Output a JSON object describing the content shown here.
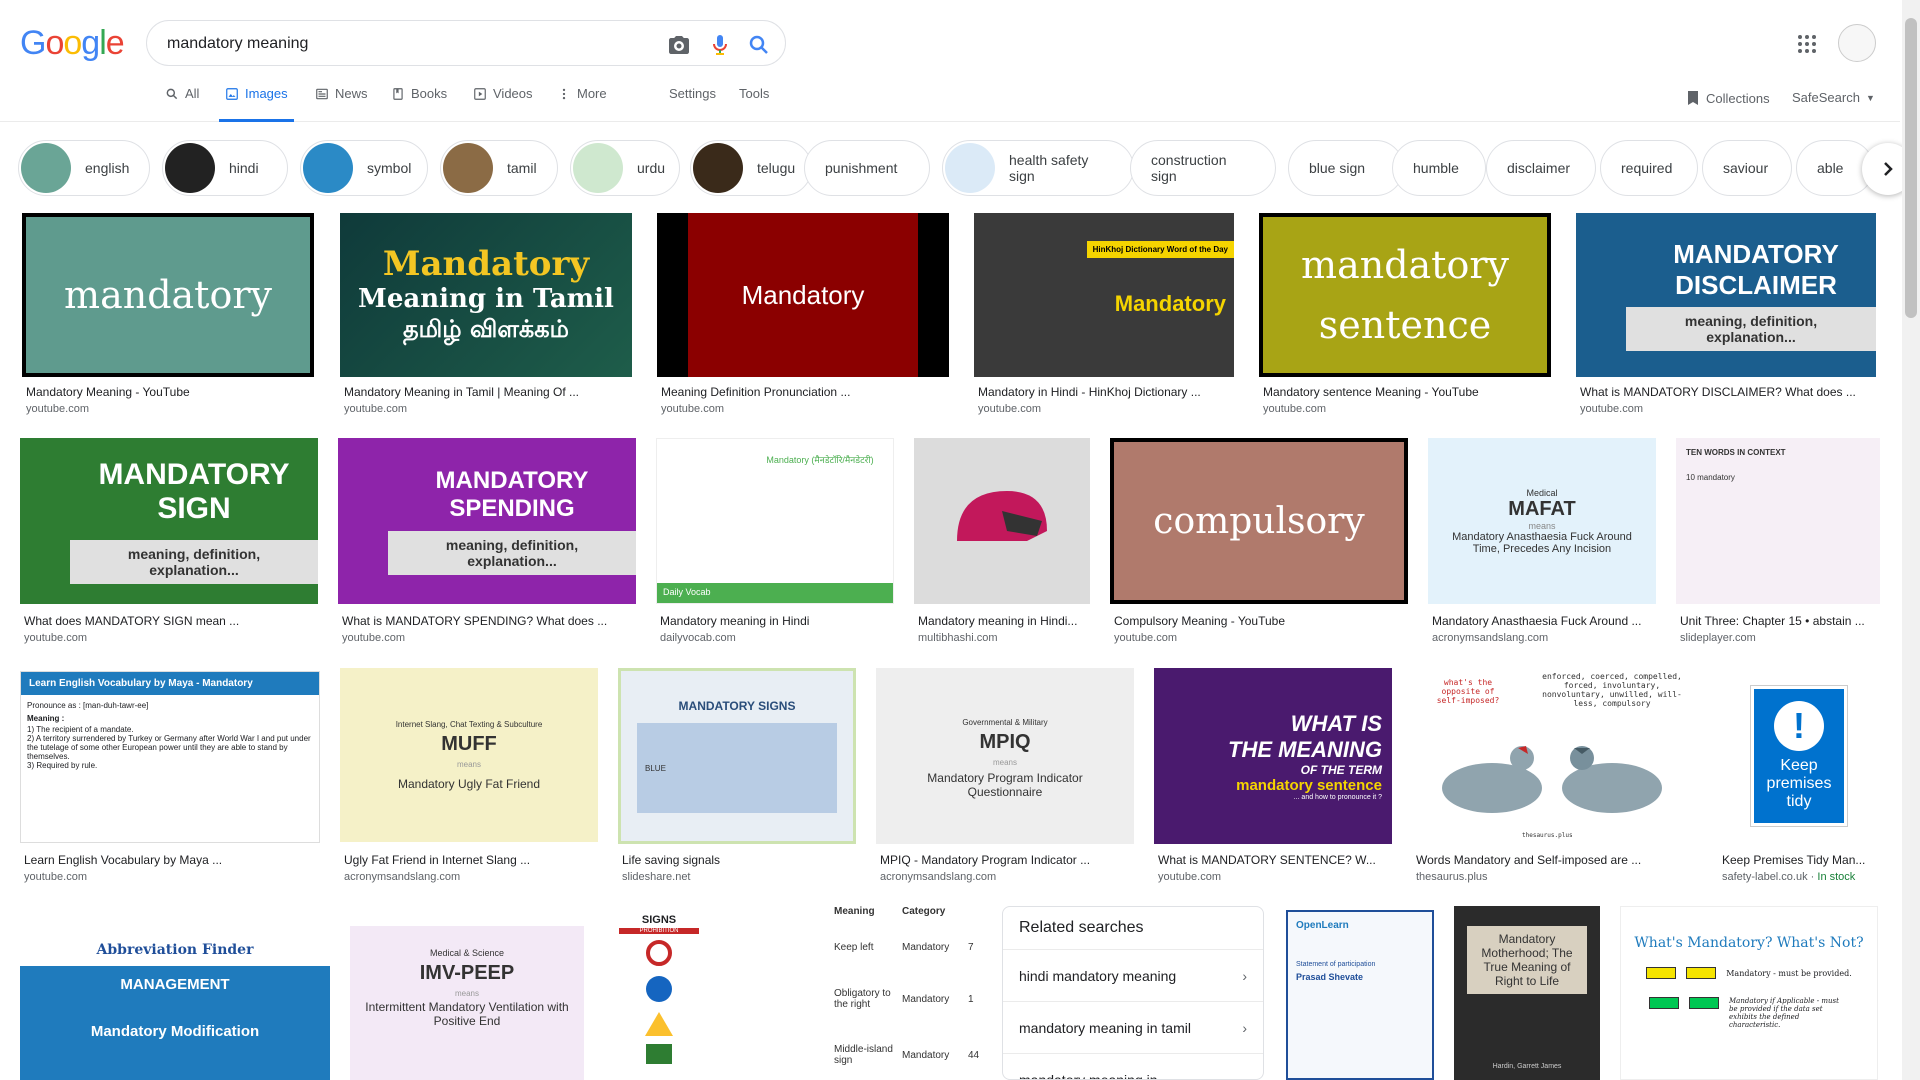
{
  "search": {
    "query": "mandatory meaning"
  },
  "tabs": {
    "all": "All",
    "images": "Images",
    "news": "News",
    "books": "Books",
    "videos": "Videos",
    "more": "More",
    "settings": "Settings",
    "tools": "Tools"
  },
  "header_right": {
    "collections": "Collections",
    "safesearch": "SafeSearch"
  },
  "chips": [
    "english",
    "hindi",
    "symbol",
    "tamil",
    "urdu",
    "telugu",
    "punishment",
    "health safety sign",
    "construction sign",
    "blue sign",
    "humble",
    "disclaimer",
    "required",
    "saviour",
    "able"
  ],
  "results": [
    {
      "title": "Mandatory Meaning - YouTube",
      "source": "youtube.com",
      "img_text": "mandatory",
      "bg": "#5f9b8e"
    },
    {
      "title": "Mandatory Meaning in Tamil | Meaning Of ...",
      "source": "youtube.com",
      "img_line1": "Mandatory",
      "img_line2": "Meaning in Tamil",
      "img_line3": "தமிழ் விளக்கம்",
      "bg": "#1e4d40"
    },
    {
      "title": "Meaning Definition Pronunciation ...",
      "source": "youtube.com",
      "img_text": "Mandatory",
      "bg": "#8b0000"
    },
    {
      "title": "Mandatory in Hindi - HinKhoj Dictionary ...",
      "source": "youtube.com",
      "img_banner": "HinKhoj Dictionary Word of the Day",
      "img_text": "Mandatory",
      "bg": "#222222"
    },
    {
      "title": "Mandatory sentence Meaning - YouTube",
      "source": "youtube.com",
      "img_line1": "mandatory",
      "img_line2": "sentence",
      "bg": "#a8a415"
    },
    {
      "title": "What is MANDATORY DISCLAIMER? What does ...",
      "source": "youtube.com",
      "img_line1": "MANDATORY",
      "img_line2": "DISCLAIMER",
      "img_sub": "meaning, definition, explanation...",
      "bg": "#1b5e8e"
    },
    {
      "title": "What does MANDATORY SIGN mean ...",
      "source": "youtube.com",
      "img_line1": "MANDATORY SIGN",
      "img_sub": "meaning, definition, explanation...",
      "bg": "#2e7d32"
    },
    {
      "title": "What is MANDATORY SPENDING? What does ...",
      "source": "youtube.com",
      "img_line1": "MANDATORY",
      "img_line2": "SPENDING",
      "img_sub": "meaning, definition, explanation...",
      "bg": "#8e24aa"
    },
    {
      "title": "Mandatory meaning in Hindi",
      "source": "dailyvocab.com",
      "img_text": "Mandatory (मैनडेटॉरि/मैनडेटरी)",
      "img_sub": "Daily Vocab",
      "bg": "#ffffff"
    },
    {
      "title": "Mandatory meaning in Hindi...",
      "source": "multibhashi.com",
      "bg": "#dcdcdc"
    },
    {
      "title": "Compulsory Meaning - YouTube",
      "source": "youtube.com",
      "img_text": "compulsory",
      "bg": "#b07a6c"
    },
    {
      "title": "Mandatory Anasthaesia Fuck Around ...",
      "source": "acronymsandslang.com",
      "img_cat": "Medical",
      "img_line1": "MAFAT",
      "img_means": "means",
      "img_sub": "Mandatory Anasthaesia Fuck Around Time, Precedes Any Incision",
      "bg": "#e3f2fb"
    },
    {
      "title": "Unit Three: Chapter 15 • abstain ...",
      "source": "slideplayer.com",
      "img_line1": "TEN WORDS IN CONTEXT",
      "img_sub": "10 mandatory",
      "bg": "#f6eff6"
    },
    {
      "title": "Learn English Vocabulary by Maya ...",
      "source": "youtube.com",
      "img_banner": "Learn English Vocabulary by Maya - Mandatory",
      "img_sub": "Pronounce as : [man-duh-tawr-ee]",
      "img_def": "Meaning :",
      "img_d1": "1) The recipient of a mandate.",
      "img_d2": "2) A territory surrendered by Turkey or Germany after World War I and put under the tutelage of some other European power until they are able to stand by themselves.",
      "img_d3": "3) Required by rule.",
      "bg": "#ffffff"
    },
    {
      "title": "Ugly Fat Friend in Internet Slang ...",
      "source": "acronymsandslang.com",
      "img_cat": "Internet Slang, Chat Texting & Subculture",
      "img_line1": "MUFF",
      "img_means": "means",
      "img_sub": "Mandatory Ugly Fat Friend",
      "bg": "#f5f1c8"
    },
    {
      "title": "Life saving signals",
      "source": "slideshare.net",
      "img_line1": "MANDATORY SIGNS",
      "img_sub": "BLUE",
      "bg": "#e8eef4"
    },
    {
      "title": "MPIQ - Mandatory Program Indicator ...",
      "source": "acronymsandslang.com",
      "img_cat": "Governmental & Military",
      "img_line1": "MPIQ",
      "img_means": "means",
      "img_sub": "Mandatory Program Indicator Questionnaire",
      "bg": "#eeeeee"
    },
    {
      "title": "What is MANDATORY SENTENCE? W...",
      "source": "youtube.com",
      "img_line1": "WHAT IS",
      "img_line2": "THE MEANING",
      "img_line3": "OF THE TERM",
      "img_sub": "mandatory sentence",
      "img_def": "... and how to pronounce it ?",
      "bg": "#4a1a6e"
    },
    {
      "title": "Words Mandatory and Self-imposed are ...",
      "source": "thesaurus.plus",
      "img_line1": "what's the opposite of self-imposed?",
      "img_sub": "enforced, coerced, compelled, forced, involuntary, nonvoluntary, unwilled, will-less, compulsory",
      "img_def": "thesaurus.plus",
      "bg": "#ffffff"
    },
    {
      "title": "Keep Premises Tidy Man...",
      "source": "safety-label.co.uk",
      "stock": "In stock",
      "img_text": "Keep premises tidy",
      "bg": "#ffffff"
    },
    {
      "title": "",
      "source": "",
      "img_line1": "Abbreviation Finder",
      "img_line2": "MANAGEMENT",
      "img_sub": "Mandatory Modification",
      "bg": "#1f7bbd"
    },
    {
      "title": "",
      "source": "",
      "img_cat": "Medical & Science",
      "img_line1": "IMV-PEEP",
      "img_means": "means",
      "img_sub": "Intermittent Mandatory Ventilation with Positive End",
      "bg": "#f3e9f6"
    },
    {
      "title": "",
      "source": "",
      "img_line1": "SIGNS",
      "img_sub": "PROHIBITION",
      "bg": "#ffffff"
    },
    {
      "title": "",
      "source": "",
      "img_line1": "Meaning",
      "img_line2": "Category",
      "img_sub": "Keep left",
      "img_def": "Obligatory to the right",
      "img_d1": "Middle-island sign",
      "img_c1": "Mandatory",
      "img_n1": "7",
      "img_n2": "1",
      "img_n3": "44",
      "bg": "#ffffff"
    },
    {
      "title": "",
      "source": "",
      "img_line1": "OpenLearn",
      "img_sub": "Statement of participation",
      "img_def": "Prasad Shevate",
      "bg": "#f5f8fc"
    },
    {
      "title": "",
      "source": "",
      "img_line1": "Mandatory Motherhood; The True Meaning of Right to Life",
      "img_sub": "Hardin, Garrett James",
      "bg": "#2b2b2b"
    },
    {
      "title": "",
      "source": "",
      "img_line1": "What's Mandatory?  What's Not?",
      "img_sub": "Mandatory - must be provided.",
      "img_def": "Mandatory if Applicable - must be provided if the data set exhibits the defined characteristic.",
      "bg": "#ffffff"
    }
  ],
  "related": {
    "heading": "Related searches",
    "items": [
      "hindi mandatory meaning",
      "mandatory meaning in tamil",
      "mandatory meaning in"
    ]
  }
}
